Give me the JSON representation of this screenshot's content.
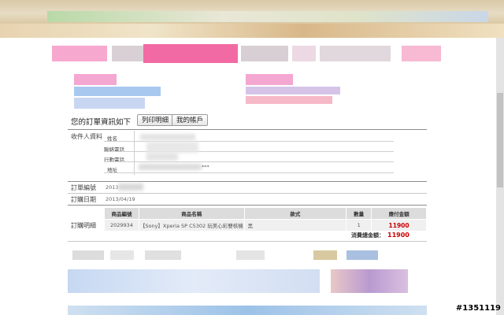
{
  "order": {
    "heading": "您的訂單資訊如下",
    "print_button": "列印明細",
    "account_button": "我的帳戶",
    "recipient": {
      "section_label": "收件人資料",
      "name_label": "姓名",
      "phone_label": "聯絡電話",
      "mobile_label": "行動電話",
      "address_label": "地址",
      "address_suffix": "***"
    },
    "order_number": {
      "label": "訂單編號",
      "value": "2013"
    },
    "order_date": {
      "label": "訂購日期",
      "value": "2013/04/19"
    },
    "details": {
      "label": "訂購明細",
      "headers": [
        "商品編號",
        "商品名稱",
        "款式",
        "數量",
        "應付金額"
      ],
      "rows": [
        {
          "code": "2029934",
          "name": "【Sony】Xperia SP C5302 玩美心彩雙核機",
          "style": "黑",
          "qty": "1",
          "price": "11900"
        }
      ],
      "total_label": "消費總金額：",
      "total_value": "11900"
    }
  },
  "watermark": "#1351119",
  "colors": {
    "price": "#cc0000",
    "header_bg": "#dcdcdc",
    "row_bg": "#f0f0f0"
  }
}
